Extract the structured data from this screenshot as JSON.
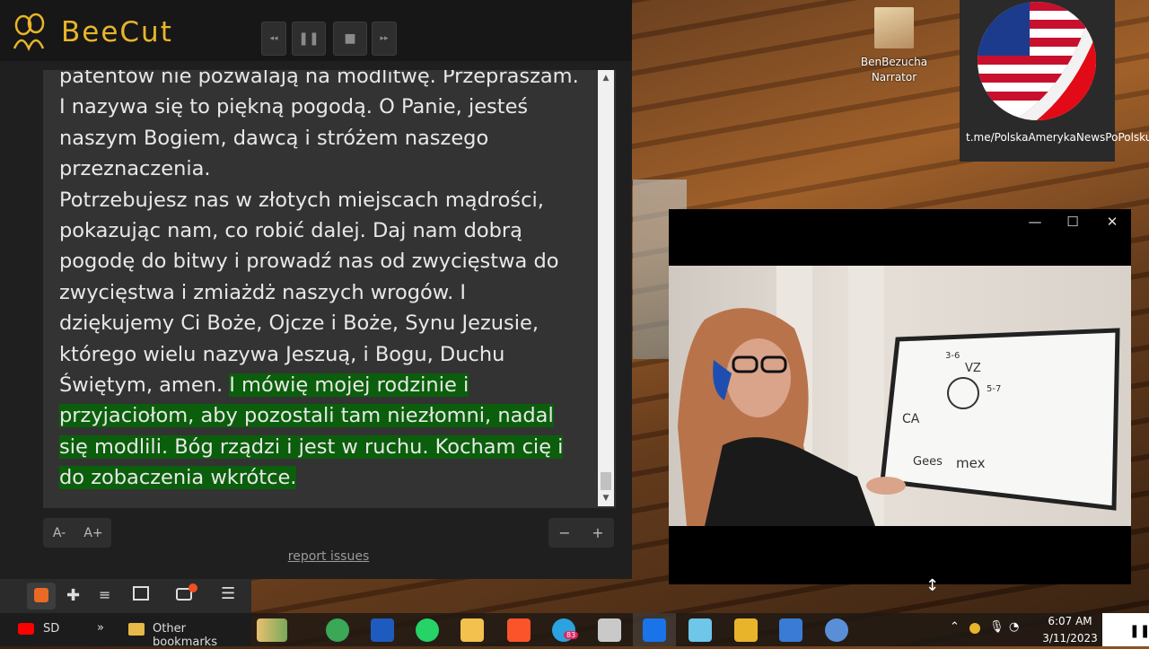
{
  "app": {
    "name": "BeeCut",
    "player": {
      "rewind": "◂◂",
      "pause": "❚❚",
      "stop": "■",
      "forward": "▸▸"
    }
  },
  "reader": {
    "lines_plain": [
      "patentów nie pozwalają na modlitwę. Przepraszam.",
      "I nazywa się to piękną pogodą. O Panie, jesteś",
      "naszym Bogiem, dawcą i stróżem naszego",
      "przeznaczenia.",
      "Potrzebujesz nas w złotych miejscach mądrości,",
      "pokazując nam, co robić dalej. Daj nam dobrą",
      "pogodę do bitwy i prowadź nas od zwycięstwa do",
      "zwycięstwa i zmiażdż naszych wrogów. I",
      "dziękujemy Ci Boże, Ojcze i Boże, Synu Jezusie,",
      "którego wielu nazywa Jeszuą, i Bogu, Duchu"
    ],
    "line11_plain": "Świętym, amen. ",
    "line11_highlight": "I mówię mojej rodzinie i",
    "lines_highlight": [
      "przyjaciołom, aby pozostali tam niezłomni, nadal",
      "się modlili. Bóg rządzi i jest w ruchu. Kocham cię i",
      "do zobaczenia wkrótce."
    ],
    "highlight_color": "#0b5e0b"
  },
  "controls": {
    "font_smaller": "A-",
    "font_larger": "A+",
    "minus": "−",
    "plus": "+",
    "report": "report issues"
  },
  "overlay": {
    "narrator_name": "BenBezucha",
    "narrator_role": "Narrator",
    "channel_link": "t.me/PolskaAmerykaNewsPoPolsku"
  },
  "video_window": {
    "minimize": "—",
    "maximize": "☐",
    "close": "✕",
    "whiteboard_text": [
      "3-6",
      "VZ",
      "5-7",
      "CA",
      "Gees",
      "mex"
    ]
  },
  "browser": {
    "bookmark_sd": "SD",
    "more": "»",
    "other_bookmarks": "Other bookmarks"
  },
  "taskbar": {
    "telegram_badge": "83",
    "time": "6:07 AM",
    "date": "3/11/2023"
  }
}
